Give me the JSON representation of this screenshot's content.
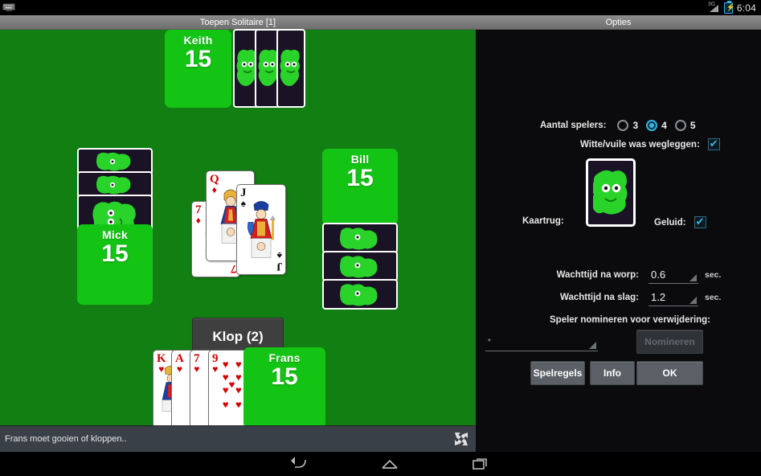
{
  "statusbar": {
    "time": "6:04",
    "network_label": "3G",
    "icons": [
      "keyboard-icon",
      "signal-icon",
      "battery-charging-icon"
    ]
  },
  "titlebar": {
    "game_title": "Toepen Solitaire [1]",
    "options_title": "Opties"
  },
  "game": {
    "table_color": "#117f11",
    "panel_color": "#14c414",
    "klop_button": "Klop (2)",
    "status_message": "Frans moet gooien of kloppen..",
    "players": [
      {
        "name": "Keith",
        "score": "15",
        "position": "top",
        "facedown_cards": 3
      },
      {
        "name": "Mick",
        "score": "15",
        "position": "left",
        "facedown_cards": 3
      },
      {
        "name": "Bill",
        "score": "15",
        "position": "right",
        "facedown_cards": 3
      },
      {
        "name": "Frans",
        "score": "15",
        "position": "bottom",
        "facedown_cards": 0
      }
    ],
    "trick_cards": [
      {
        "rank": "7",
        "suit": "♦",
        "color": "red"
      },
      {
        "rank": "Q",
        "suit": "♦",
        "color": "red"
      },
      {
        "rank": "J",
        "suit": "♠",
        "color": "black"
      }
    ],
    "hand_cards": [
      {
        "rank": "K",
        "suit": "♥",
        "color": "red"
      },
      {
        "rank": "A",
        "suit": "♥",
        "color": "red"
      },
      {
        "rank": "7",
        "suit": "♥",
        "color": "red"
      },
      {
        "rank": "9",
        "suit": "♥",
        "color": "red"
      }
    ],
    "fullscreen_icon": "fullscreen-icon"
  },
  "options": {
    "players_label": "Aantal spelers:",
    "players_choices": [
      "3",
      "4",
      "5"
    ],
    "players_selected": "4",
    "wash_label": "Witte/vuile was wegleggen:",
    "wash_checked": true,
    "cardback_label": "Kaartrug:",
    "sound_label": "Geluid:",
    "sound_checked": true,
    "wait_throw_label": "Wachttijd na worp:",
    "wait_throw_value": "0.6",
    "wait_throw_unit": "sec.",
    "wait_trick_label": "Wachttijd na slag:",
    "wait_trick_value": "1.2",
    "wait_trick_unit": "sec.",
    "nominate_label": "Speler nomineren voor verwijdering:",
    "nominate_select_value": "*",
    "nominate_button": "Nomineren",
    "rules_button": "Spelregels",
    "info_button": "Info",
    "ok_button": "OK",
    "accent_color": "#33b5e5"
  },
  "navbar": {
    "back": "back-icon",
    "home": "home-icon",
    "recents": "recents-icon"
  }
}
